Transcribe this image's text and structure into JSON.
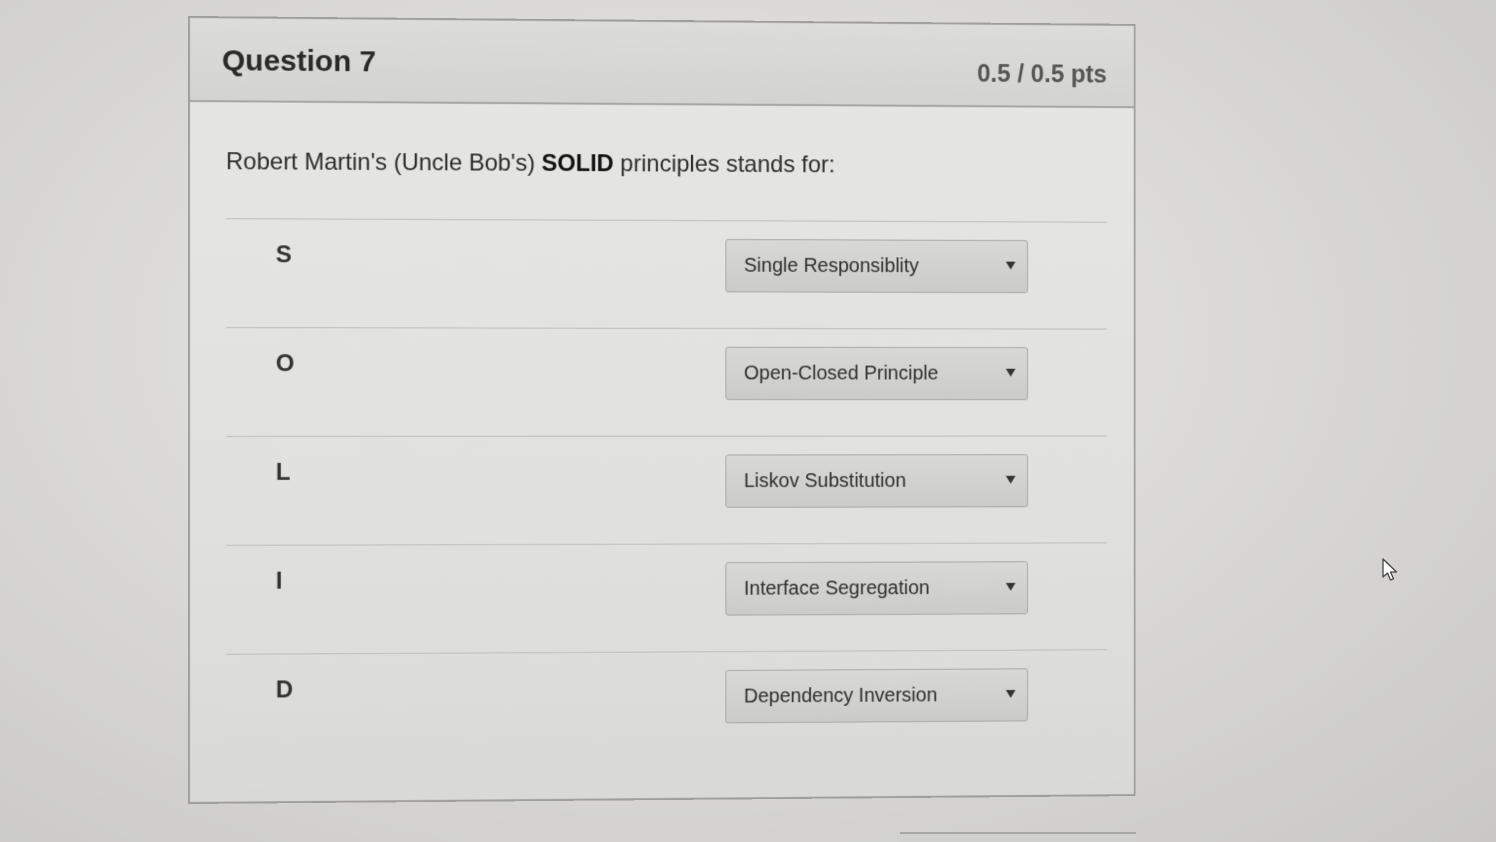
{
  "question": {
    "title": "Question 7",
    "points": "0.5 / 0.5 pts",
    "prompt_prefix": "Robert Martin's (Uncle Bob's) ",
    "prompt_bold": "SOLID",
    "prompt_suffix": " principles stands for:"
  },
  "rows": [
    {
      "letter": "S",
      "selected": "Single Responsiblity"
    },
    {
      "letter": "O",
      "selected": "Open-Closed Principle"
    },
    {
      "letter": "L",
      "selected": "Liskov Substitution"
    },
    {
      "letter": "I",
      "selected": "Interface Segregation"
    },
    {
      "letter": "D",
      "selected": "Dependency Inversion"
    }
  ],
  "icons": {
    "dropdown": "chevron-down-icon",
    "pointer": "mouse-cursor-icon"
  }
}
